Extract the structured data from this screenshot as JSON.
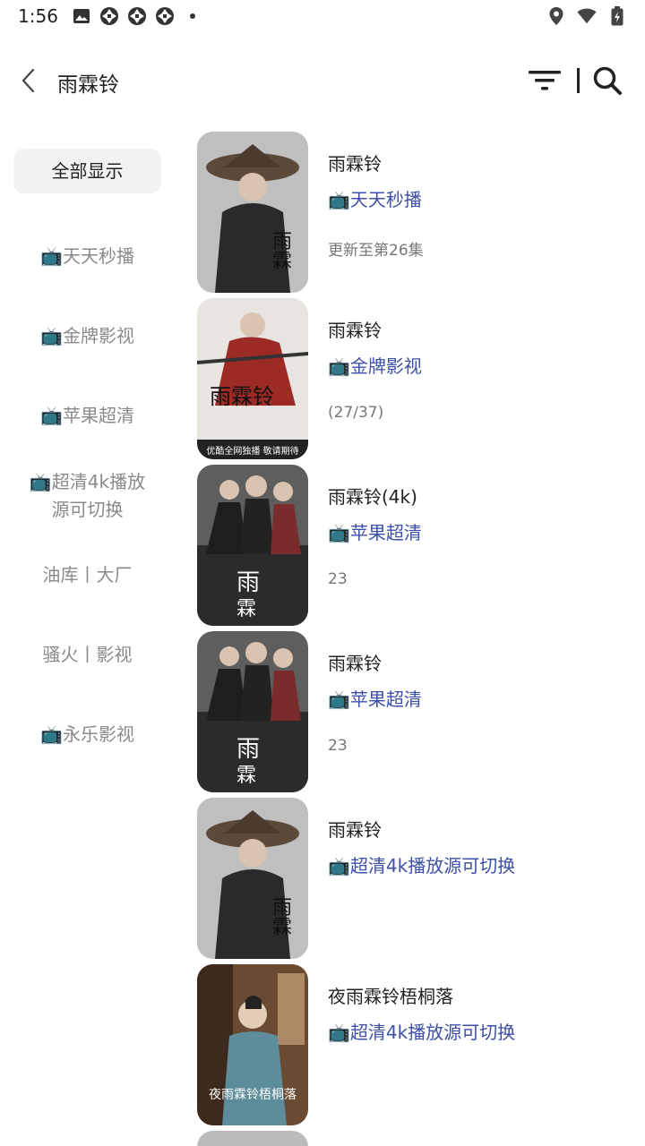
{
  "status_bar": {
    "time": "1:56",
    "left_icons": [
      "image-icon",
      "aperture-icon",
      "aperture-icon",
      "aperture-icon",
      "dot-icon"
    ],
    "right_icons": [
      "location-icon",
      "wifi-icon",
      "battery-icon"
    ]
  },
  "header": {
    "title": "雨霖铃",
    "back_icon": "chevron-left-icon",
    "filter_icon": "filter-icon",
    "search_icon": "search-icon"
  },
  "sidebar": {
    "items": [
      {
        "label": "全部显示",
        "active": true
      },
      {
        "label": "📺天天秒播"
      },
      {
        "label": "📺金牌影视"
      },
      {
        "label": "📺苹果超清"
      },
      {
        "label": "📺超清4k播放源可切换"
      },
      {
        "label": "油库丨大厂"
      },
      {
        "label": "骚火丨影视"
      },
      {
        "label": "📺永乐影视"
      }
    ]
  },
  "results": [
    {
      "title": "雨霖铃",
      "source": "📺天天秒播",
      "remark": "更新至第26集",
      "poster_text": ""
    },
    {
      "title": "雨霖铃",
      "source": "📺金牌影视",
      "remark": "(27/37)",
      "poster_text": "优酷全网独播 敬请期待"
    },
    {
      "title": "雨霖铃(4k)",
      "source": "📺苹果超清",
      "remark": "23",
      "poster_text": ""
    },
    {
      "title": "雨霖铃",
      "source": "📺苹果超清",
      "remark": "23",
      "poster_text": ""
    },
    {
      "title": "雨霖铃",
      "source": "📺超清4k播放源可切换",
      "remark": "",
      "poster_text": ""
    },
    {
      "title": "夜雨霖铃梧桐落",
      "source": "📺超清4k播放源可切换",
      "remark": "",
      "poster_text": "夜雨霖铃梧桐落"
    }
  ],
  "colors": {
    "source_link": "#3d4fa8",
    "sidebar_inactive": "#8a8a8a",
    "sidebar_active_bg": "#f2f2f2"
  }
}
